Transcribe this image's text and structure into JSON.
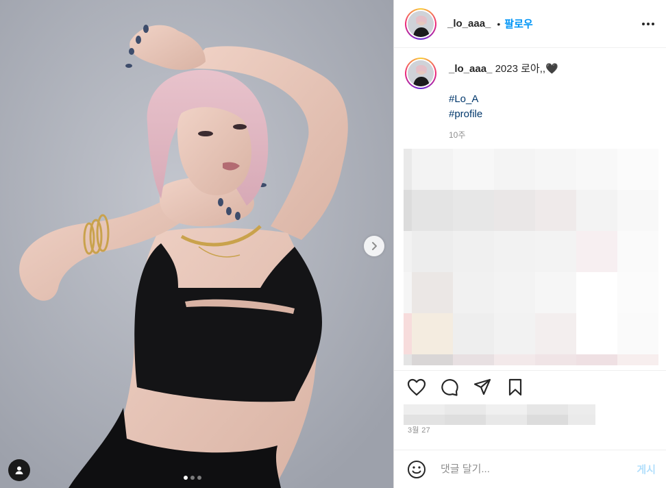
{
  "post": {
    "username": "_lo_aaa_",
    "separator": "•",
    "follow_label": "팔로우",
    "more_icon": "more-options-icon"
  },
  "caption": {
    "username": "_lo_aaa_",
    "text": "2023 로아,,🖤",
    "hashtags": [
      "#Lo_A",
      "#profile"
    ],
    "age": "10주"
  },
  "media": {
    "carousel_count": 3,
    "carousel_active_index": 0,
    "next_icon": "chevron-right-icon",
    "tag_icon": "user-tag-icon"
  },
  "actions": {
    "like_icon": "heart-icon",
    "comment_icon": "comment-icon",
    "share_icon": "paper-plane-icon",
    "save_icon": "bookmark-icon"
  },
  "date": "3월 27",
  "comment": {
    "placeholder": "댓글 달기...",
    "post_label": "게시",
    "emoji_icon": "emoji-icon"
  },
  "colors": {
    "accent": "#0095f6",
    "hashtag": "#00376b",
    "post_disabled": "#b2dffc",
    "muted": "#8e8e8e"
  }
}
